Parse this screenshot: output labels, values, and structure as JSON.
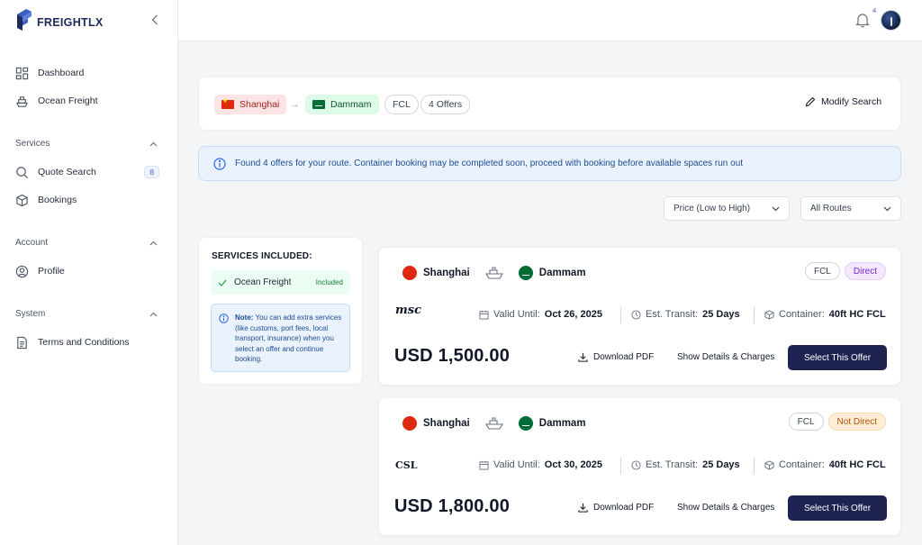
{
  "app": {
    "logo_text": "FREIGHTLX"
  },
  "sidebar": {
    "top_items": [
      {
        "label": "Dashboard",
        "icon": "grid-icon"
      },
      {
        "label": "Ocean Freight",
        "icon": "ship-icon"
      }
    ],
    "sections": [
      {
        "title": "Services",
        "items": [
          {
            "label": "Quote Search",
            "icon": "search-icon",
            "badge": "8"
          },
          {
            "label": "Bookings",
            "icon": "box-icon"
          }
        ]
      },
      {
        "title": "Account",
        "items": [
          {
            "label": "Profile",
            "icon": "user-circle-icon"
          }
        ]
      },
      {
        "title": "System",
        "items": [
          {
            "label": "Terms and Conditions",
            "icon": "document-icon"
          }
        ]
      }
    ]
  },
  "topbar": {
    "notification_count": "4"
  },
  "search": {
    "origin": "Shanghai",
    "destination": "Dammam",
    "mode": "FCL",
    "offers_count": "4 Offers",
    "modify_label": "Modify Search"
  },
  "info_banner": "Found 4 offers for your route. Container booking may be completed soon, proceed with booking before available spaces run out",
  "filters": {
    "sort": "Price (Low to High)",
    "routes": "All Routes"
  },
  "services": {
    "title": "SERVICES INCLUDED:",
    "item": "Ocean Freight",
    "item_status": "Included",
    "note_label": "Note:",
    "note_text": " You can add extra services (like customs, port fees, local transport, insurance) when you select an offer and continue booking."
  },
  "offers": [
    {
      "origin": "Shanghai",
      "destination": "Dammam",
      "mode": "FCL",
      "routing": "Direct",
      "carrier": "msc",
      "valid_label": "Valid Until:",
      "valid_value": "Oct 26, 2025",
      "transit_label": "Est. Transit:",
      "transit_value": "25 Days",
      "container_label": "Container:",
      "container_value": "40ft HC FCL",
      "price": "USD 1,500.00",
      "download_label": "Download PDF",
      "details_label": "Show Details & Charges",
      "select_label": "Select This Offer"
    },
    {
      "origin": "Shanghai",
      "destination": "Dammam",
      "mode": "FCL",
      "routing": "Not Direct",
      "carrier": "CSL",
      "valid_label": "Valid Until:",
      "valid_value": "Oct 30, 2025",
      "transit_label": "Est. Transit:",
      "transit_value": "25 Days",
      "container_label": "Container:",
      "container_value": "40ft HC FCL",
      "price": "USD 1,800.00",
      "download_label": "Download PDF",
      "details_label": "Show Details & Charges",
      "select_label": "Select This Offer"
    }
  ],
  "colors": {
    "brand_navy": "#1e2352",
    "info_blue": "#eaf2fd",
    "direct_purple": "#7e22ce",
    "not_direct_orange": "#b45309"
  }
}
